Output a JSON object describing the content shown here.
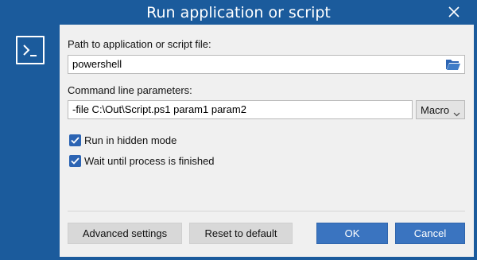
{
  "window": {
    "title": "Run application or script"
  },
  "form": {
    "path_label": "Path to application or script file:",
    "path_value": "powershell",
    "params_label": "Command line parameters:",
    "params_value": "-file C:\\Out\\Script.ps1 param1 param2",
    "macro_label": "Macro",
    "hidden_label": "Run in hidden mode",
    "hidden_checked": true,
    "wait_label": "Wait until process is finished",
    "wait_checked": true
  },
  "buttons": {
    "advanced": "Advanced settings",
    "reset": "Reset to default",
    "ok": "OK",
    "cancel": "Cancel"
  },
  "icons": {
    "app": "terminal-icon",
    "browse": "folder-open-icon",
    "close": "close-icon",
    "dropdown": "chevron-down-icon",
    "check": "checkmark-icon"
  },
  "colors": {
    "frame": "#1b5b9c",
    "primary_button": "#3a74c0",
    "checkbox": "#2c64b3",
    "panel": "#f0f0f0"
  }
}
